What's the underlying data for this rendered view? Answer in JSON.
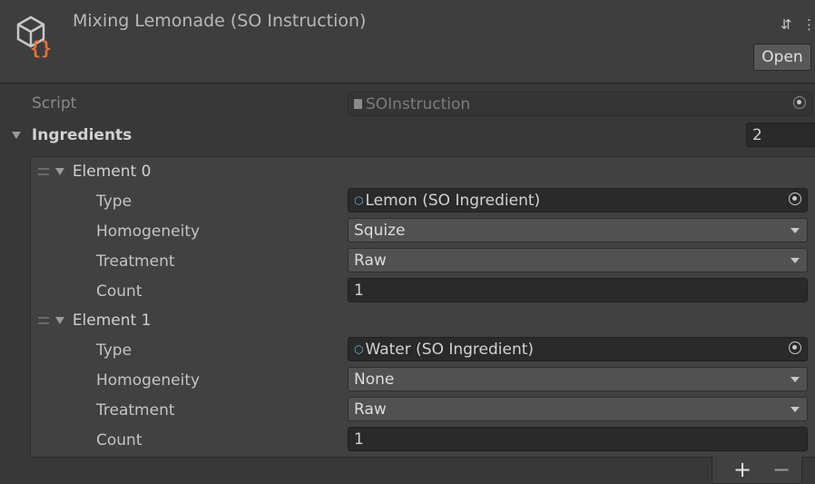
{
  "header": {
    "title": "Mixing Lemonade (SO Instruction)",
    "open_label": "Open",
    "logo_icon": "scriptable-object-icon",
    "settings_icon": "preset-sliders-icon",
    "menu_icon": "kebab-menu-icon"
  },
  "script_field": {
    "label": "Script",
    "value": "SOInstruction"
  },
  "ingredients": {
    "label": "Ingredients",
    "size": "2",
    "add_label": "+",
    "remove_label": "−",
    "elements": [
      {
        "label": "Element 0",
        "type_label": "Type",
        "type_value": "Lemon (SO Ingredient)",
        "homogeneity_label": "Homogeneity",
        "homogeneity_value": "Squize",
        "treatment_label": "Treatment",
        "treatment_value": "Raw",
        "count_label": "Count",
        "count_value": "1"
      },
      {
        "label": "Element 1",
        "type_label": "Type",
        "type_value": "Water (SO Ingredient)",
        "homogeneity_label": "Homogeneity",
        "homogeneity_value": "None",
        "treatment_label": "Treatment",
        "treatment_value": "Raw",
        "count_label": "Count",
        "count_value": "1"
      }
    ]
  },
  "colors": {
    "background": "#383838",
    "header": "#3e3e3e",
    "field": "#2a2a2a",
    "dropdown": "#515151",
    "logo_orange": "#e8703a"
  }
}
